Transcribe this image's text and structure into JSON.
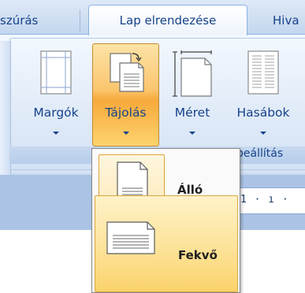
{
  "tabs": {
    "left_partial": "szúrás",
    "active": "Lap elrendezése",
    "right_partial": "Hiva"
  },
  "ribbon": {
    "buttons": [
      {
        "label": "Margók",
        "icon": "margins-icon"
      },
      {
        "label": "Tájolás",
        "icon": "orientation-icon"
      },
      {
        "label": "Méret",
        "icon": "page-size-icon"
      },
      {
        "label": "Hasábok",
        "icon": "columns-icon"
      }
    ],
    "group_label_partial": "beállítás"
  },
  "ruler": {
    "text": "1 · ı ·"
  },
  "menu": {
    "items": [
      {
        "label": "Álló",
        "icon": "portrait-page-icon"
      },
      {
        "label": "Fekvő",
        "icon": "landscape-page-icon"
      }
    ]
  },
  "colors": {
    "ribbon_text": "#15428b",
    "highlight": "#fbc56e",
    "menu_hover": "#fde49e"
  }
}
